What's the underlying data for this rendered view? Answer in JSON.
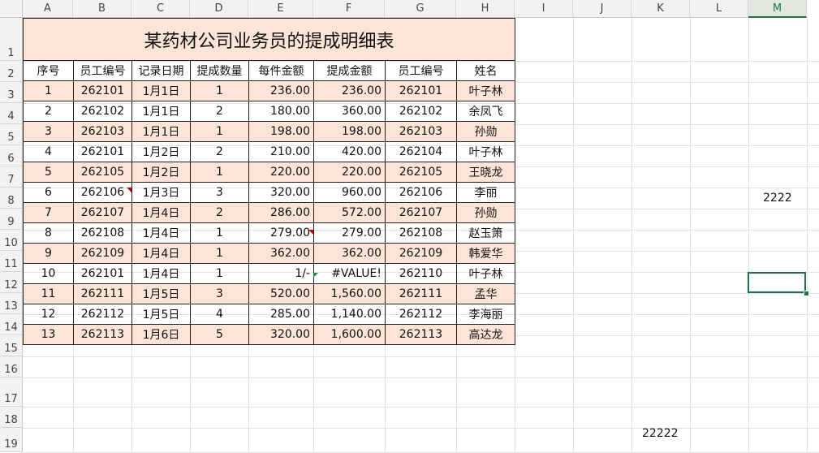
{
  "columns": [
    "A",
    "B",
    "C",
    "D",
    "E",
    "F",
    "G",
    "H",
    "I",
    "J",
    "K",
    "L",
    "M"
  ],
  "rows": [
    "1",
    "2",
    "3",
    "4",
    "5",
    "6",
    "7",
    "8",
    "9",
    "10",
    "11",
    "12",
    "13",
    "14",
    "15",
    "16",
    "17",
    "18",
    "19"
  ],
  "active_cell": "M12",
  "table": {
    "title": "某药材公司业务员的提成明细表",
    "headers": [
      "序号",
      "员工编号",
      "记录日期",
      "提成数量",
      "每件金额",
      "提成金额",
      "员工编号",
      "姓名"
    ],
    "rows": [
      [
        "1",
        "262101",
        "1月1日",
        "1",
        "236.00",
        "236.00",
        "262101",
        "叶子林"
      ],
      [
        "2",
        "262102",
        "1月1日",
        "2",
        "180.00",
        "360.00",
        "262102",
        "余凤飞"
      ],
      [
        "3",
        "262103",
        "1月1日",
        "1",
        "198.00",
        "198.00",
        "262103",
        "孙勋"
      ],
      [
        "4",
        "262101",
        "1月2日",
        "2",
        "210.00",
        "420.00",
        "262104",
        "叶子林"
      ],
      [
        "5",
        "262105",
        "1月2日",
        "1",
        "220.00",
        "220.00",
        "262105",
        "王晓龙"
      ],
      [
        "6",
        "262106",
        "1月3日",
        "3",
        "320.00",
        "960.00",
        "262106",
        "李丽"
      ],
      [
        "7",
        "262107",
        "1月4日",
        "2",
        "286.00",
        "572.00",
        "262107",
        "孙勋"
      ],
      [
        "8",
        "262108",
        "1月4日",
        "1",
        "279.00",
        "279.00",
        "262108",
        "赵玉箫"
      ],
      [
        "9",
        "262109",
        "1月4日",
        "1",
        "362.00",
        "362.00",
        "262109",
        "韩爱华"
      ],
      [
        "10",
        "262101",
        "1月4日",
        "1",
        "1/-",
        "#VALUE!",
        "262110",
        "叶子林"
      ],
      [
        "11",
        "262111",
        "1月5日",
        "3",
        "520.00",
        "1,560.00",
        "262111",
        "孟华"
      ],
      [
        "12",
        "262112",
        "1月5日",
        "4",
        "285.00",
        "1,140.00",
        "262112",
        "李海丽"
      ],
      [
        "13",
        "262113",
        "1月6日",
        "5",
        "320.00",
        "1,600.00",
        "262113",
        "高达龙"
      ]
    ]
  },
  "cells": {
    "M8": "2222",
    "K19": "22222"
  },
  "colors": {
    "shade": "#fce4d6",
    "accent": "#217346"
  }
}
